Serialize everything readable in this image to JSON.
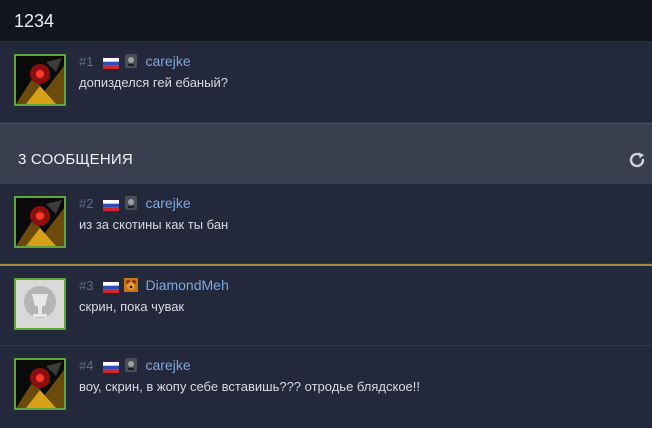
{
  "window": {
    "title": "1234"
  },
  "posts": [
    {
      "number": "#1",
      "author": "carejke",
      "message": "допизделся гей ебаный?",
      "avatar": "avatar-dark",
      "badge": "dark-badge-icon"
    },
    {
      "number": "#2",
      "author": "carejke",
      "message": "из за скотины как ты бан",
      "avatar": "avatar-dark",
      "badge": "dark-badge-icon"
    },
    {
      "number": "#3",
      "author": "DiamondMeh",
      "message": "скрин, пока чувак",
      "avatar": "avatar-silver",
      "badge": "bear-badge-icon"
    },
    {
      "number": "#4",
      "author": "carejke",
      "message": "воу, скрин, в жопу себе вставишь??? отродье блядское!!",
      "avatar": "avatar-dark",
      "badge": "dark-badge-icon"
    }
  ],
  "section": {
    "title": "3 СООБЩЕНИЯ",
    "refresh_icon": "refresh-icon"
  },
  "colors": {
    "username": "#7fa7e0",
    "avatar_border": "#5ea63b",
    "separator_gold": "#9f8a3f",
    "background": "#23283a"
  }
}
